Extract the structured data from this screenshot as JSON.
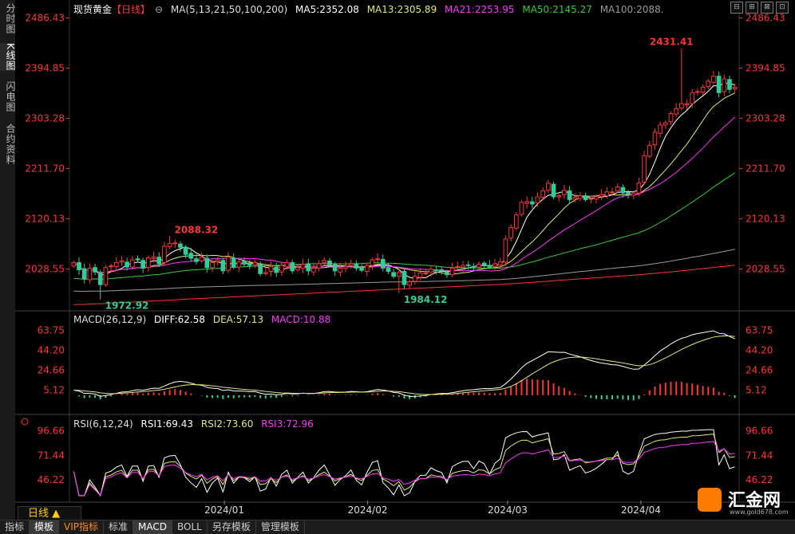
{
  "sidebar": [
    {
      "label": "分时图",
      "active": false
    },
    {
      "label": "K线图",
      "active": true
    },
    {
      "label": "闪电图",
      "active": false
    },
    {
      "label": "合约资料",
      "active": false
    }
  ],
  "header": {
    "instrument": "现货黄金",
    "period": "【日线】",
    "ma_label": "MA(5,13,21,50,100,200)",
    "ma5": "MA5:2352.08",
    "ma13": "MA13:2305.89",
    "ma21": "MA21:2253.95",
    "ma50": "MA50:2145.27",
    "ma100": "MA100:2088.",
    "window_buttons": [
      "⊟",
      "⊞",
      "⊠",
      "⊡"
    ]
  },
  "macd_legend": {
    "name": "MACD(26,12,9)",
    "diff": "DIFF:62.58",
    "dea": "DEA:57.13",
    "macd": "MACD:10.88"
  },
  "rsi_legend": {
    "name": "RSI(6,12,24)",
    "rsi1": "RSI1:69.43",
    "rsi2": "RSI2:73.60",
    "rsi3": "RSI3:72.96"
  },
  "bottom_tabs": [
    {
      "label": "指标",
      "active": false,
      "vip": false
    },
    {
      "label": "模板",
      "active": true,
      "vip": false
    },
    {
      "label": "VIP指标",
      "active": false,
      "vip": true
    },
    {
      "label": "标准",
      "active": false,
      "vip": false
    },
    {
      "label": "MACD",
      "active": true,
      "vip": false
    },
    {
      "label": "BOLL",
      "active": false,
      "vip": false
    },
    {
      "label": "另存模板",
      "active": false,
      "vip": false
    },
    {
      "label": "管理模板",
      "active": false,
      "vip": false
    }
  ],
  "period_button": "日线 ▲",
  "logo": {
    "text": "汇金网",
    "url": "www.gold678.com"
  },
  "colors": {
    "up": "#ff3333",
    "down": "#33cc99",
    "ma5": "#ffffff",
    "ma13": "#e6e66e",
    "ma21": "#ff33ff",
    "ma50": "#33cc33",
    "ma100": "#999999",
    "ma200": "#ff3333",
    "label": "#ff3333",
    "axis": "#ff3333"
  },
  "chart_data": {
    "type": "candlestick",
    "x_labels": [
      "2024/01",
      "2024/02",
      "2024/03",
      "2024/04"
    ],
    "price_ticks": [
      2486.43,
      2394.85,
      2303.28,
      2211.7,
      2120.13,
      2028.55
    ],
    "price_range": [
      1955,
      2490
    ],
    "annotations": [
      {
        "text": "2088.32",
        "index": 18,
        "price": 2088.32
      },
      {
        "text": "1972.92",
        "index": 5,
        "price": 1972.92
      },
      {
        "text": "1984.12",
        "index": 61,
        "price": 1984.12
      },
      {
        "text": "2431.41",
        "index": 114,
        "price": 2431.41
      }
    ],
    "closes": [
      2040,
      2027,
      2010,
      2030,
      2023,
      2000,
      2031,
      2034,
      2040,
      2043,
      2032,
      2045,
      2045,
      2030,
      2049,
      2050,
      2038,
      2070,
      2075,
      2076,
      2068,
      2055,
      2048,
      2042,
      2050,
      2031,
      2040,
      2045,
      2025,
      2050,
      2032,
      2041,
      2040,
      2035,
      2040,
      2020,
      2022,
      2033,
      2022,
      2035,
      2040,
      2025,
      2031,
      2037,
      2025,
      2030,
      2038,
      2044,
      2036,
      2025,
      2030,
      2033,
      2038,
      2030,
      2026,
      2035,
      2045,
      2047,
      2030,
      2024,
      2015,
      2022,
      2000,
      2005,
      2015,
      2021,
      2021,
      2028,
      2026,
      2025,
      2018,
      2030,
      2033,
      2035,
      2035,
      2032,
      2037,
      2036,
      2032,
      2038,
      2041,
      2083,
      2104,
      2127,
      2150,
      2151,
      2147,
      2160,
      2171,
      2185,
      2160,
      2162,
      2172,
      2155,
      2159,
      2162,
      2155,
      2157,
      2160,
      2164,
      2169,
      2169,
      2178,
      2167,
      2165,
      2167,
      2185,
      2235,
      2254,
      2278,
      2291,
      2295,
      2312,
      2321,
      2330,
      2330,
      2350,
      2352,
      2360,
      2371,
      2380,
      2350,
      2375,
      2356,
      2360
    ],
    "indicators": {
      "macd": {
        "ticks": [
          63.75,
          44.2,
          24.66,
          5.12
        ],
        "range": [
          -15,
          72
        ],
        "diff": 62.58,
        "dea": 57.13,
        "macd": 10.88
      },
      "rsi": {
        "ticks": [
          96.66,
          71.44,
          46.22
        ],
        "range": [
          25,
          103
        ],
        "rsi1": 69.43,
        "rsi2": 73.6,
        "rsi3": 72.96
      }
    }
  }
}
